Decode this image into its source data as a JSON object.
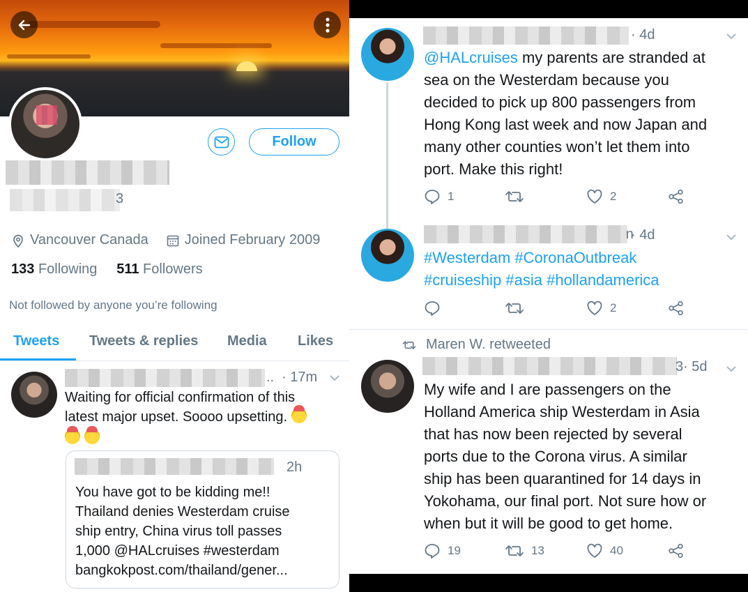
{
  "profile": {
    "location": "Vancouver Canada",
    "joined": "Joined February 2009",
    "following_count": "133",
    "following_label": "Following",
    "followers_count": "511",
    "followers_label": "Followers",
    "not_followed": "Not followed by anyone you’re following",
    "follow_label": "Follow",
    "handle_tail": "3"
  },
  "tabs": [
    "Tweets",
    "Tweets & replies",
    "Media",
    "Likes"
  ],
  "left_tweet": {
    "name_tail": "..",
    "time": "· 17m",
    "line1": "Waiting for official confirmation of this",
    "line2": "latest major upset. Soooo upsetting.",
    "quote": {
      "time": "2h",
      "lines": [
        "You have got to be kidding me!!",
        "Thailand denies Westerdam cruise",
        "ship entry, China virus toll passes",
        "1,000 @HALcruises #westerdam",
        "bangkokpost.com/thailand/gener..."
      ]
    }
  },
  "right": {
    "tweet1": {
      "time": "· 4d",
      "mention": "@HALcruises",
      "rest_line1": " my parents are stranded at",
      "lines": [
        "sea on the Westerdam because you",
        "decided to pick up 800 passengers from",
        "Hong Kong last week and now Japan and",
        "many other counties won’t let them into",
        "port. Make this right!"
      ],
      "replies": "1",
      "retweets": "",
      "likes": "2"
    },
    "tweet2": {
      "name_tail": " n",
      "time": "· 4d",
      "line1": "#Westerdam #CoronaOutbreak",
      "line2": "#cruiseship #asia #hollandamerica",
      "replies": "",
      "retweets": "",
      "likes": "2"
    },
    "retweeted_by": "Maren W. retweeted",
    "tweet3": {
      "name_tail": "3",
      "time": "· 5d",
      "lines": [
        "My wife and I are passengers on the",
        "Holland America ship Westerdam in Asia",
        "that has now been rejected by several",
        "ports due to the Corona virus. A similar",
        "ship has been quarantined for 14 days in",
        "Yokohama, our final port. Not sure how or",
        "when but it will be good to get home."
      ],
      "replies": "19",
      "retweets": "13",
      "likes": "40"
    }
  },
  "colors": {
    "accent": "#1da1f2",
    "muted": "#657786",
    "border": "#e1e8ed"
  },
  "icons": [
    "back-arrow-icon",
    "more-vertical-icon",
    "mail-icon",
    "location-pin-icon",
    "calendar-icon",
    "chevron-down-icon",
    "reply-icon",
    "retweet-icon",
    "heart-icon",
    "share-icon"
  ]
}
